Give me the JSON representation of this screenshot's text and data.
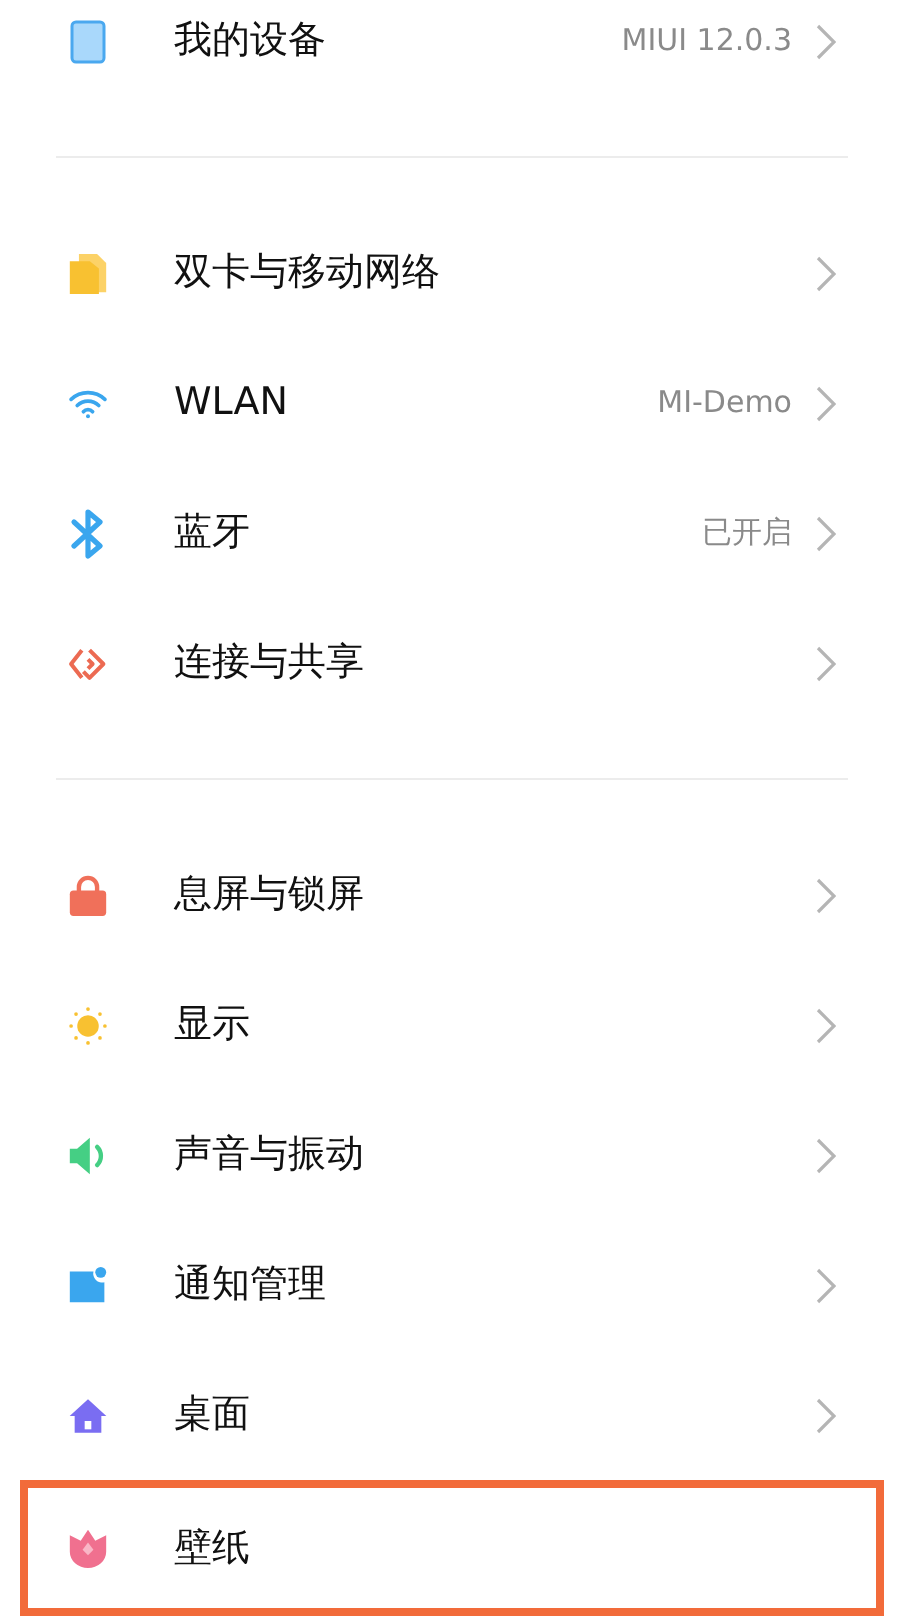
{
  "groups": [
    {
      "items": [
        {
          "label": "我的设备",
          "value": "MIUI 12.0.3",
          "chevron": true,
          "highlighted": false
        }
      ]
    },
    {
      "items": [
        {
          "label": "双卡与移动网络",
          "chevron": true,
          "highlighted": false
        },
        {
          "label": "WLAN",
          "value": "MI-Demo",
          "chevron": true,
          "highlighted": false
        },
        {
          "label": "蓝牙",
          "value": "已开启",
          "chevron": true,
          "highlighted": false
        },
        {
          "label": "连接与共享",
          "chevron": true,
          "highlighted": false
        }
      ]
    },
    {
      "items": [
        {
          "label": "息屏与锁屏",
          "chevron": true,
          "highlighted": false
        },
        {
          "label": "显示",
          "chevron": true,
          "highlighted": false
        },
        {
          "label": "声音与振动",
          "chevron": true,
          "highlighted": false
        },
        {
          "label": "通知管理",
          "chevron": true,
          "highlighted": false
        },
        {
          "label": "桌面",
          "chevron": true,
          "highlighted": false
        },
        {
          "label": "壁纸",
          "chevron": false,
          "highlighted": true
        }
      ]
    }
  ]
}
